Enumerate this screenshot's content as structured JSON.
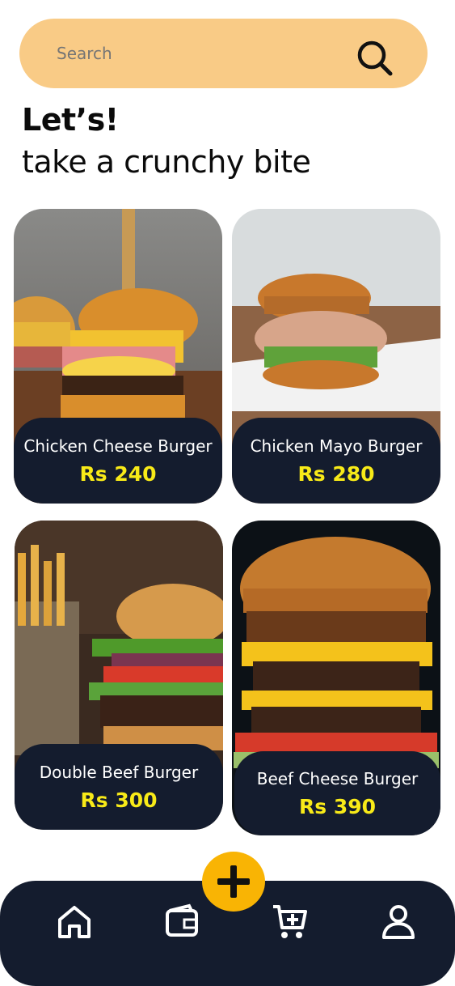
{
  "search": {
    "placeholder": "Search",
    "icon": "search-icon",
    "background": "#f9cb86"
  },
  "heading": {
    "line1": "Let’s!",
    "line2": "take a crunchy bite"
  },
  "products": [
    {
      "name": "Chicken Cheese Burger",
      "price": "Rs 240"
    },
    {
      "name": "Chicken Mayo Burger",
      "price": "Rs 280"
    },
    {
      "name": "Double Beef Burger",
      "price": "Rs 300"
    },
    {
      "name": "Beef Cheese Burger",
      "price": "Rs 390"
    }
  ],
  "colors": {
    "card_panel": "#141c2e",
    "price": "#f8ea18",
    "fab": "#f9b404",
    "navbar": "#141c2e"
  },
  "navbar": {
    "items": [
      "home-icon",
      "wallet-icon",
      "cart-add-icon",
      "profile-icon"
    ],
    "fab_icon": "plus-icon"
  }
}
